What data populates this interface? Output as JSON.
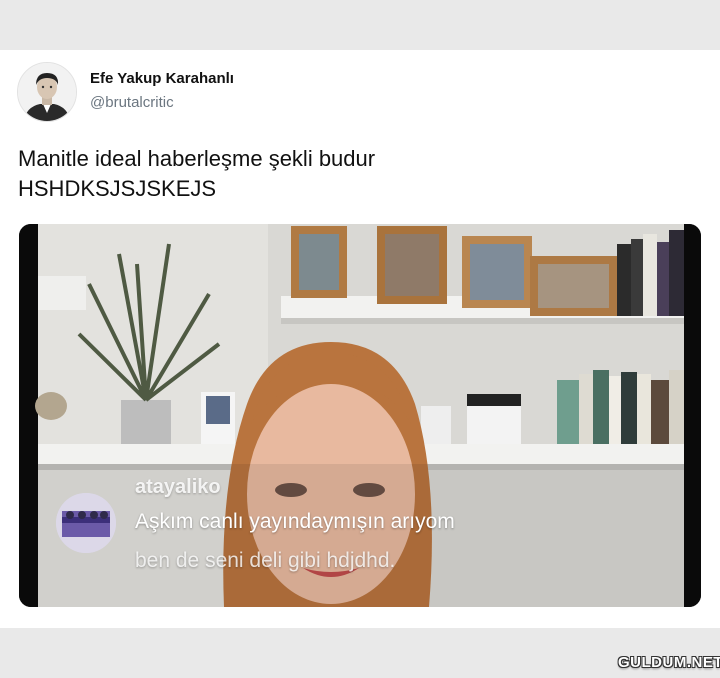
{
  "tweet": {
    "author_name": "Efe Yakup Karahanlı",
    "author_handle": "@brutalcritic",
    "text_line1": "Manitle ideal haberleşme şekli budur",
    "text_line2": "HSHDKSJSJSKEJS"
  },
  "live_comment": {
    "username": "atayaliko",
    "message_line1": "Aşkım canlı yayındaymışın arıyom",
    "message_line2": "ben de seni deli gibi hdjdhd."
  },
  "watermark": "GULDUM.NET",
  "colors": {
    "handle_gray": "#6b7680",
    "wall": "#d8d7d3",
    "hair": "#b9743e"
  }
}
